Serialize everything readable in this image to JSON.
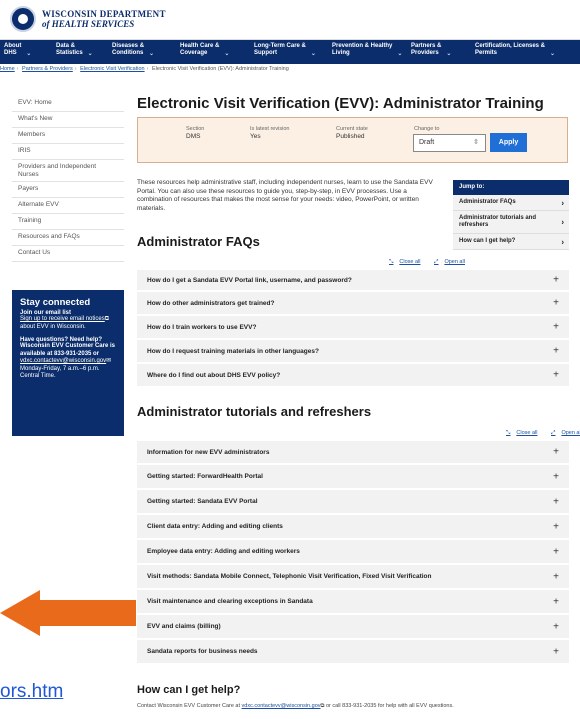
{
  "header": {
    "logo_line1": "WISCONSIN DEPARTMENT",
    "logo_line2": "of HEALTH SERVICES"
  },
  "nav": [
    {
      "l1": "About",
      "l2": "DHS"
    },
    {
      "l1": "Data &",
      "l2": "Statistics"
    },
    {
      "l1": "Diseases &",
      "l2": "Conditions"
    },
    {
      "l1": "Health Care &",
      "l2": "Coverage"
    },
    {
      "l1": "Long-Term Care &",
      "l2": "Support"
    },
    {
      "l1": "Prevention & Healthy",
      "l2": "Living"
    },
    {
      "l1": "Partners &",
      "l2": "Providers"
    },
    {
      "l1": "Certification, Licenses &",
      "l2": "Permits"
    }
  ],
  "breadcrumb": {
    "home": "Home",
    "partners": "Partners & Providers",
    "evv": "Electronic Visit Verification",
    "current": "Electronic Visit Verification (EVV): Administrator Training"
  },
  "sidebar": {
    "items": [
      "EVV: Home",
      "What's New",
      "Members",
      "IRIS",
      "Providers and Independent Nurses",
      "Payers",
      "Alternate EVV",
      "Training",
      "Resources and FAQs",
      "Contact Us"
    ],
    "stay": {
      "title": "Stay connected",
      "sub": "Join our email list",
      "signup_link": "Sign up to receive email notices",
      "signup_suffix": " about EVV in Wisconsin.",
      "questions": "Have questions? Need help?",
      "care_text": "Wisconsin EVV Customer Care is available at 833-931-2035 or",
      "email": "vdxc.contactevv@wisconsin.gov",
      "hours": " Monday-Friday, 7 a.m.–6 p.m. Central Time."
    }
  },
  "main": {
    "title": "Electronic Visit Verification (EVV): Administrator Training",
    "status": {
      "section_label": "Section",
      "section_value": "DMS",
      "latest_label": "Is latest revision",
      "latest_value": "Yes",
      "state_label": "Current state",
      "state_value": "Published",
      "change_label": "Change to",
      "change_value": "Draft",
      "apply": "Apply"
    },
    "intro": "These resources help administrative staff, including independent nurses, learn to use the Sandata EVV Portal. You can also use these resources to guide you, step-by-step, in EVV processes. Use a combination of resources that makes the most sense for your needs: video, PowerPoint, or written materials.",
    "jump": {
      "head": "Jump to:",
      "items": [
        "Administrator FAQs",
        "Administrator tutorials and refreshers",
        "How can I get help?"
      ]
    },
    "close_all": "Close all",
    "open_all": "Open all",
    "faq_title": "Administrator FAQs",
    "faqs": [
      "How do I get a Sandata EVV Portal link, username, and password?",
      "How do other administrators get trained?",
      "How do I train workers to use EVV?",
      "How do I request training materials in other languages?",
      "Where do I find out about DHS EVV policy?"
    ],
    "tut_title": "Administrator tutorials and refreshers",
    "tutorials": [
      "Information for new EVV administrators",
      "Getting started: ForwardHealth Portal",
      "Getting started: Sandata EVV Portal",
      "Client data entry: Adding and editing clients",
      "Employee data entry: Adding and editing workers",
      "Visit methods: Sandata Mobile Connect, Telephonic Visit Verification, Fixed Visit Verification",
      "Visit maintenance and clearing exceptions in Sandata",
      "EVV and claims (billing)",
      "Sandata reports for business needs"
    ],
    "help_title": "How can I get help?",
    "help_prefix": "Contact Wisconsin EVV Customer Care at ",
    "help_email": "vdxc.contactevv@wisconsin.gov",
    "help_suffix": " or call 833-931-2035 for help with all EVV questions."
  },
  "overlay": {
    "url_fragment": "ors.htm",
    "arrow_color": "#ea6a1c"
  }
}
